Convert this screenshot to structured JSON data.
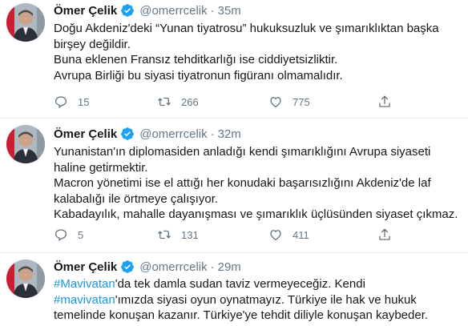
{
  "tweets": [
    {
      "name": "Ömer Çelik",
      "handle": "@omerrcelik",
      "time": "35m",
      "lines": [
        "Doğu Akdeniz'deki “Yunan tiyatrosu” hukuksuzluk ve şımarıklıktan başka birşey değildir.",
        "Buna eklenen Fransız tehditkarlığı ise ciddiyetsizliktir.",
        "Avrupa Birliği bu siyasi tiyatronun figüranı olmamalıdır."
      ],
      "replies": "15",
      "retweets": "266",
      "likes": "775"
    },
    {
      "name": "Ömer Çelik",
      "handle": "@omerrcelik",
      "time": "32m",
      "lines": [
        "Yunanistan'ın diplomasiden anladığı kendi şımarıklığını Avrupa siyaseti haline getirmektir.",
        "Macron yönetimi ise el attığı her konudaki başarısızlığını Akdeniz'de laf kalabalığı ile örtmeye çalışıyor.",
        "Kabadayılık, mahalle dayanışması ve şımarıklık üçlüsünden siyaset çıkmaz."
      ],
      "replies": "5",
      "retweets": "131",
      "likes": "411"
    },
    {
      "name": "Ömer Çelik",
      "handle": "@omerrcelik",
      "time": "29m",
      "hashtag1": "#Mavivatan",
      "text1": "'da tek damla sudan taviz vermeyeceğiz. Kendi",
      "hashtag2": "#mavivatan",
      "text2": "'ımızda siyasi oyun oynatmayız. Türkiye ile hak ve hukuk temelinde konuşan kazanır. Türkiye'ye tehdit diliyle konuşan kaybeder."
    }
  ],
  "colors": {
    "accent": "#1da1f2",
    "muted": "#657786",
    "text": "#14171a"
  },
  "icons": [
    "reply-icon",
    "retweet-icon",
    "like-icon",
    "share-icon",
    "verified-badge-icon"
  ]
}
